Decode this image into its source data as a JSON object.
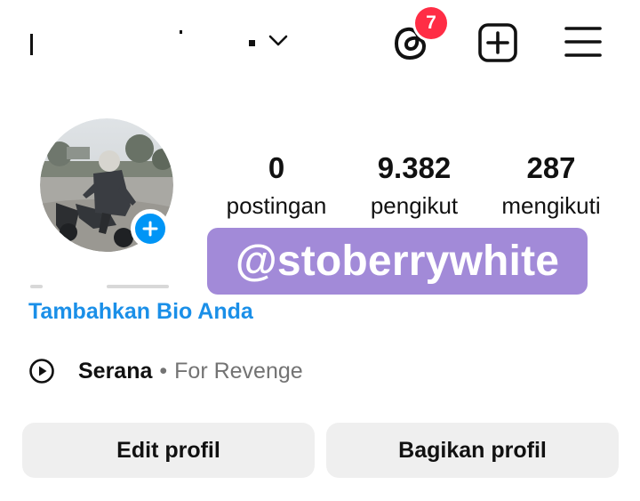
{
  "header": {
    "username_dropdown_icon": "chevron-down-icon",
    "threads_badge_count": "7",
    "icons": [
      "threads-icon",
      "create-icon",
      "menu-icon"
    ]
  },
  "profile": {
    "avatar_icon": "add-story-icon",
    "stats": [
      {
        "value": "0",
        "label": "postingan"
      },
      {
        "value": "9.382",
        "label": "pengikut"
      },
      {
        "value": "287",
        "label": "mengikuti"
      }
    ],
    "sticker_text": "@stoberrywhite",
    "bio_link": "Tambahkan Bio Anda",
    "music": {
      "song": "Serana",
      "separator": "•",
      "artist": "For Revenge"
    }
  },
  "buttons": {
    "edit_profile": "Edit profil",
    "share_profile": "Bagikan profil"
  },
  "colors": {
    "accent_blue": "#1a8fe8",
    "badge_red": "#ff2d45",
    "sticker_purple": "#a28ad8",
    "button_bg": "#efefef"
  }
}
